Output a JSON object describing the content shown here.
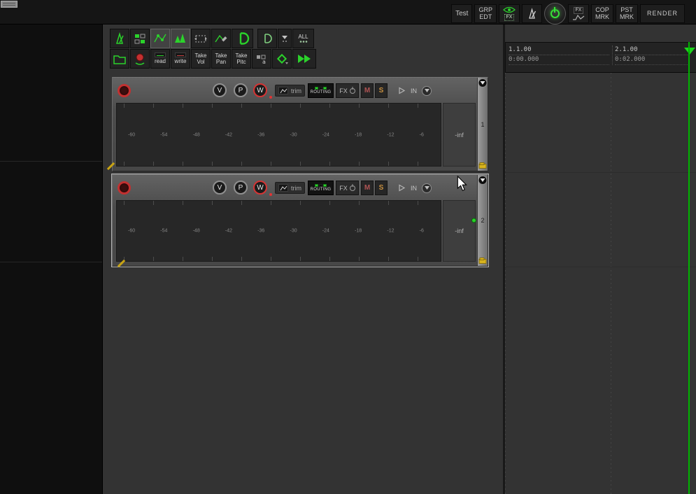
{
  "topbar": {
    "test": "Test",
    "grp_edt": [
      "GRP",
      "EDT"
    ],
    "fx_eye_label": "FX",
    "fx_env_label": "FX",
    "cop_mrk": [
      "COP",
      "MRK"
    ],
    "pst_mrk": [
      "PST",
      "MRK"
    ],
    "render": "RENDER"
  },
  "toolbar": {
    "all": "ALL",
    "read": "read",
    "write": "write",
    "take_vol": [
      "Take",
      "Vol"
    ],
    "take_pan": [
      "Take",
      "Pan"
    ],
    "take_pitch": [
      "Take",
      "Pitc"
    ]
  },
  "tracks": [
    {
      "number": "1",
      "volume_label": "V",
      "pan_label": "P",
      "width_label": "W",
      "trim_label": "trim",
      "routing_label": "ROUTING",
      "fx_label": "FX",
      "mute_label": "M",
      "solo_label": "S",
      "input_label": "IN",
      "meter_scale": [
        "-60",
        "-54",
        "-48",
        "-42",
        "-36",
        "-30",
        "-24",
        "-18",
        "-12",
        "-6"
      ],
      "meter_readout": "-inf"
    },
    {
      "number": "2",
      "volume_label": "V",
      "pan_label": "P",
      "width_label": "W",
      "trim_label": "trim",
      "routing_label": "ROUTING",
      "fx_label": "FX",
      "mute_label": "M",
      "solo_label": "S",
      "input_label": "IN",
      "meter_scale": [
        "-60",
        "-54",
        "-48",
        "-42",
        "-36",
        "-30",
        "-24",
        "-18",
        "-12",
        "-6"
      ],
      "meter_readout": "-inf"
    }
  ],
  "ruler": {
    "markers": [
      {
        "bar": "1.1.00",
        "time": "0:00.000"
      },
      {
        "bar": "2.1.00",
        "time": "0:02.000"
      }
    ]
  },
  "colors": {
    "accent_green": "#2bd22b",
    "record_red": "#c23030",
    "cursor_green": "#00b400",
    "mute_red": "#b05454",
    "solo_orange": "#c89040",
    "folder_yellow": "#d8b31e"
  }
}
